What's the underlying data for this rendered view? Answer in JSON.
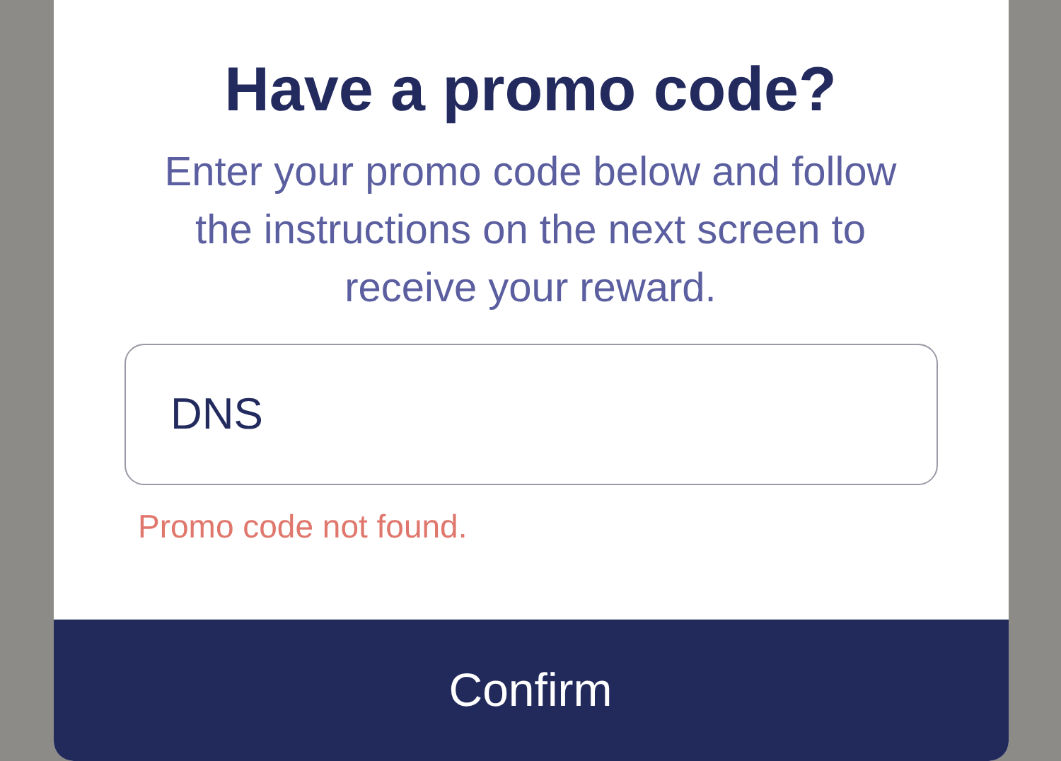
{
  "dialog": {
    "title": "Have a promo code?",
    "description": "Enter your promo code below and follow the instructions on the next screen to receive your reward.",
    "promo_field": {
      "value": "DNS",
      "error": "Promo code not found."
    },
    "confirm_button": {
      "label": "Confirm"
    }
  }
}
